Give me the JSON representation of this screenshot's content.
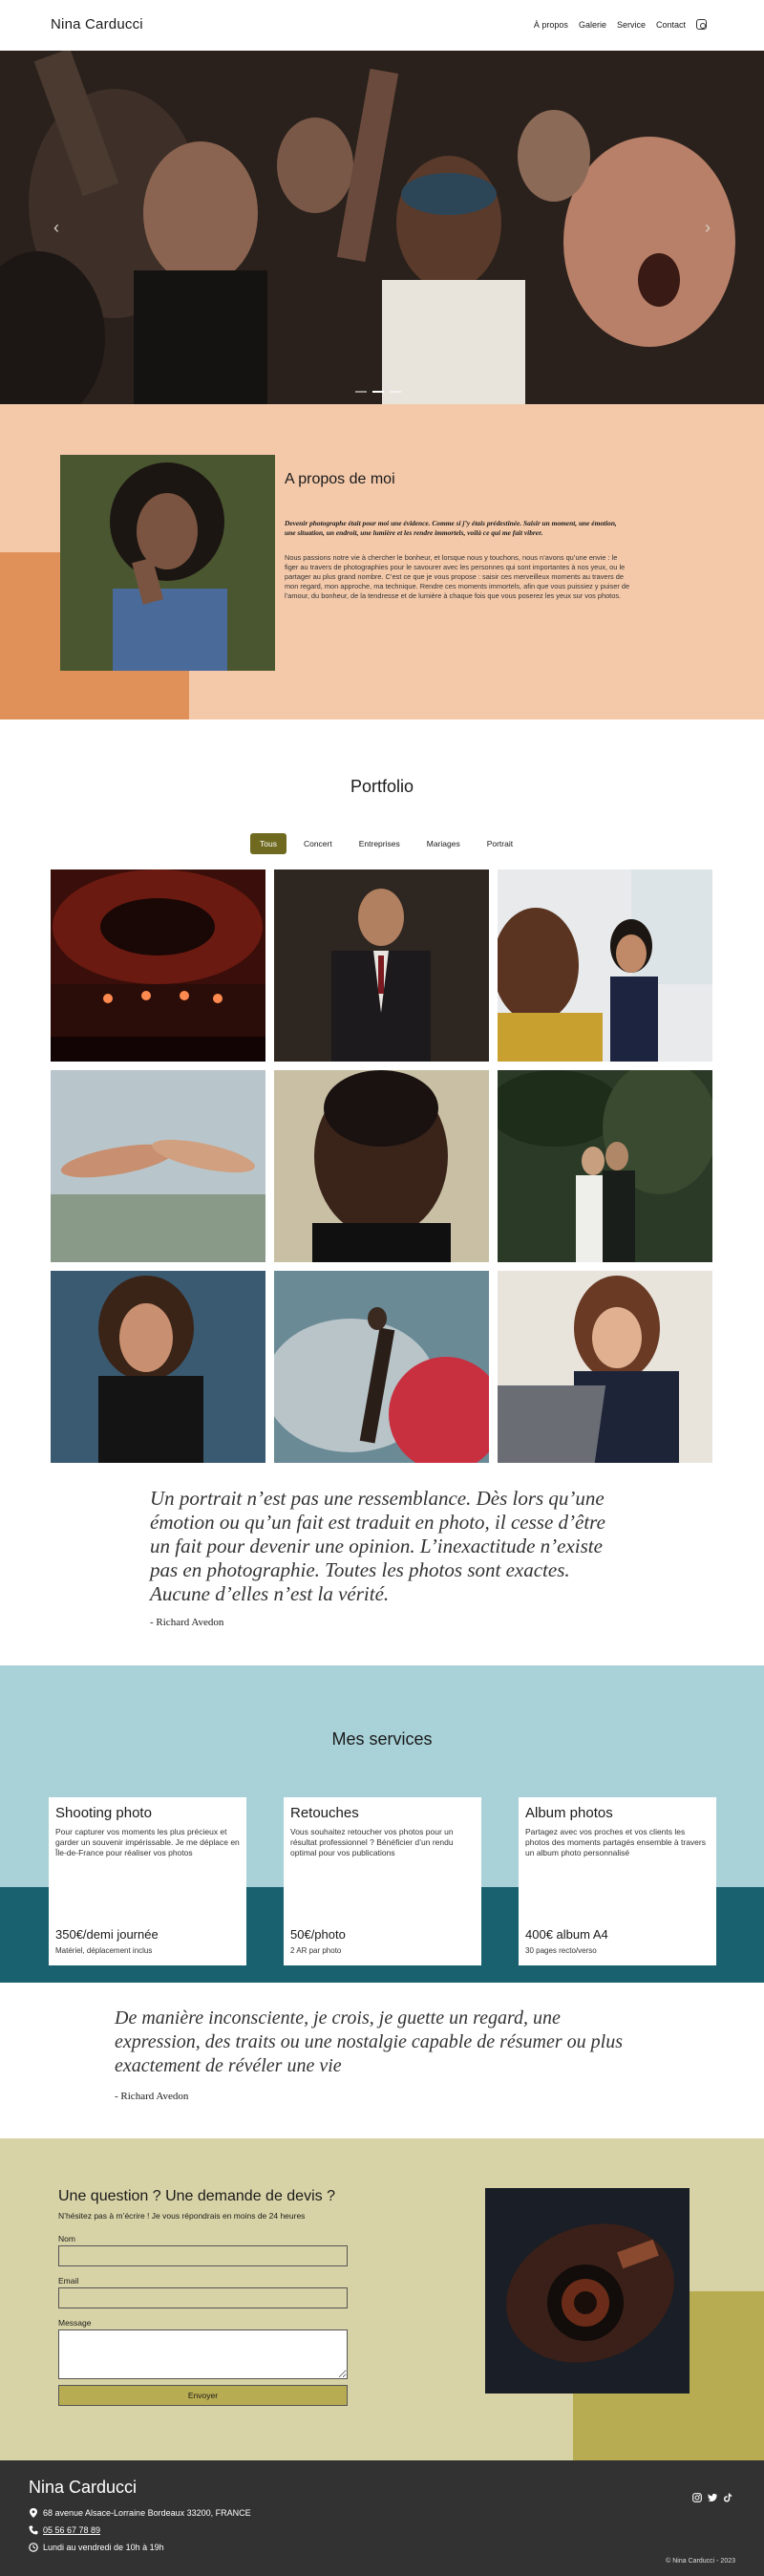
{
  "header": {
    "logo": "Nina Carducci",
    "nav": [
      "À propos",
      "Galerie",
      "Service",
      "Contact"
    ],
    "instagram_icon": "instagram-icon"
  },
  "hero": {
    "prev_icon": "chevron-left-icon",
    "next_icon": "chevron-right-icon",
    "slides_count": 3,
    "active_slide": 1
  },
  "about": {
    "title": "A propos de moi",
    "intro": "Devenir photographe était pour moi une évidence. Comme si j’y étais prédestinée. Saisir un moment, une émotion, une situation, un endroit, une lumière et les rendre immortels, voilà ce qui me fait vibrer.",
    "body": "Nous passions notre vie à chercher le bonheur, et lorsque nous y touchons, nous n’avons qu’une envie : le figer au travers de photographies pour le savourer avec les personnes qui sont importantes à nos yeux, ou le partager au plus grand nombre. C’est ce que je vous propose : saisir ces merveilleux moments au travers de mon regard, mon approche, ma technique. Rendre ces moments immortels, afin que vous puissiez y puiser de l’amour, du bonheur, de la tendresse et de lumière à chaque fois que vous poserez les yeux sur vos photos."
  },
  "portfolio": {
    "title": "Portfolio",
    "filters": [
      "Tous",
      "Concert",
      "Entreprises",
      "Mariages",
      "Portrait"
    ],
    "active_filter": "Tous"
  },
  "quotes": [
    {
      "text": "Un portrait n’est pas une ressemblance. Dès lors qu’une émotion ou qu’un fait est traduit en photo, il cesse d’être un fait pour devenir une opinion. L’inexactitude n’existe pas en photographie. Toutes les photos sont exactes. Aucune d’elles n’est la vérité.",
      "author": "- Richard Avedon"
    },
    {
      "text": "De manière inconsciente, je crois, je guette un regard, une expression, des traits ou une nostalgie capable de résumer ou plus exactement de révéler une vie",
      "author": "- Richard Avedon"
    }
  ],
  "services": {
    "title": "Mes services",
    "cards": [
      {
        "name": "Shooting photo",
        "desc": "Pour capturer vos moments les plus précieux et garder un souvenir impérissable. Je me déplace en Île-de-France pour réaliser vos photos",
        "price": "350€/demi journée",
        "note": "Matériel, déplacement inclus"
      },
      {
        "name": "Retouches",
        "desc": "Vous souhaitez retoucher vos photos pour un résultat professionnel ? Bénéficier d’un rendu optimal pour vos publications",
        "price": "50€/photo",
        "note": "2 AR par photo"
      },
      {
        "name": "Album photos",
        "desc": "Partagez avec vos proches et vos clients les photos des moments partagés ensemble à travers un album photo personnalisé",
        "price": "400€ album A4",
        "note": "30 pages recto/verso"
      }
    ]
  },
  "contact": {
    "title": "Une question ? Une demande de devis ?",
    "subtitle": "N’hésitez pas à m’écrire ! Je vous répondrais en moins de 24 heures",
    "labels": {
      "name": "Nom",
      "email": "Email",
      "message": "Message"
    },
    "values": {
      "name": "",
      "email": "",
      "message": ""
    },
    "submit": "Envoyer"
  },
  "footer": {
    "name": "Nina Carducci",
    "address": "68 avenue Alsace-Lorraine Bordeaux 33200, FRANCE",
    "phone": "05 56 67 78 89",
    "hours": "Lundi au vendredi de 10h à 19h",
    "copyright": "© Nina Carducci - 2023",
    "social_icons": [
      "instagram-icon",
      "twitter-icon",
      "tiktok-icon"
    ]
  },
  "colors": {
    "about_bg": "#f4c9aa",
    "about_accent": "#e0915a",
    "filter_active": "#6f6a1f",
    "services_bg": "#a8d2d8",
    "services_dark": "#1a6170",
    "contact_bg": "#d8d3a6",
    "contact_accent": "#b8ac52",
    "footer_bg": "#323232"
  }
}
